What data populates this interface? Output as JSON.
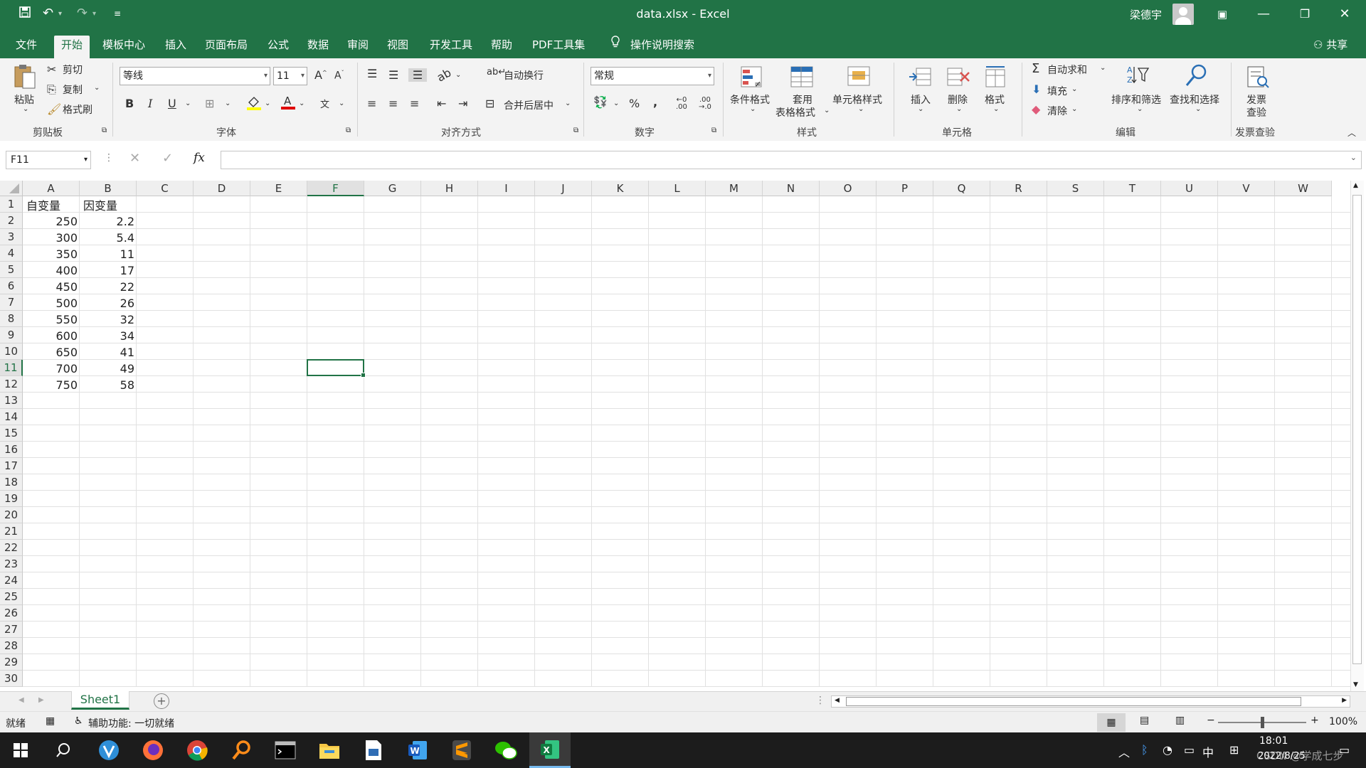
{
  "window": {
    "title": "data.xlsx  -  Excel",
    "user": "梁德宇"
  },
  "menu_tabs": [
    "文件",
    "开始",
    "模板中心",
    "插入",
    "页面布局",
    "公式",
    "数据",
    "审阅",
    "视图",
    "开发工具",
    "帮助",
    "PDF工具集"
  ],
  "active_tab": "开始",
  "tell_me": "操作说明搜索",
  "share": "共享",
  "ribbon": {
    "clipboard": {
      "label": "剪贴板",
      "paste": "粘贴",
      "cut": "剪切",
      "copy": "复制",
      "format_painter": "格式刷"
    },
    "font": {
      "label": "字体",
      "font_name": "等线",
      "font_size": "11",
      "bold": "B",
      "italic": "I",
      "underline": "U"
    },
    "alignment": {
      "label": "对齐方式",
      "wrap": "自动换行",
      "merge": "合并后居中"
    },
    "number": {
      "label": "数字",
      "format": "常规",
      "percent": "%",
      "comma": ","
    },
    "styles": {
      "label": "样式",
      "conditional": "条件格式",
      "table_format_1": "套用",
      "table_format_2": "表格格式",
      "cell_styles": "单元格样式"
    },
    "cells": {
      "label": "单元格",
      "insert": "插入",
      "delete": "删除",
      "format": "格式"
    },
    "editing": {
      "label": "编辑",
      "autosum": "自动求和",
      "fill": "填充",
      "clear": "清除",
      "sort": "排序和筛选",
      "find": "查找和选择"
    },
    "invoice": {
      "label": "发票查验",
      "btn_1": "发票",
      "btn_2": "查验"
    }
  },
  "formula_bar": {
    "name_box": "F11",
    "fx": "fx",
    "content": ""
  },
  "columns": [
    "A",
    "B",
    "C",
    "D",
    "E",
    "F",
    "G",
    "H",
    "I",
    "J",
    "K",
    "L",
    "M",
    "N",
    "O",
    "P",
    "Q",
    "R",
    "S",
    "T",
    "U",
    "V",
    "W"
  ],
  "selected_col": "F",
  "rows": [
    "1",
    "2",
    "3",
    "4",
    "5",
    "6",
    "7",
    "8",
    "9",
    "10",
    "11",
    "12",
    "13",
    "14",
    "15",
    "16",
    "17",
    "18",
    "19",
    "20",
    "21",
    "22",
    "23",
    "24",
    "25",
    "26",
    "27",
    "28",
    "29",
    "30"
  ],
  "selected_row": "11",
  "sheet_cells": {
    "A1": "自变量",
    "B1": "因变量",
    "A": [
      "250",
      "300",
      "350",
      "400",
      "450",
      "500",
      "550",
      "600",
      "650",
      "700",
      "750"
    ],
    "B": [
      "2.2",
      "5.4",
      "11",
      "17",
      "22",
      "26",
      "32",
      "34",
      "41",
      "49",
      "58"
    ]
  },
  "sheet_tab": "Sheet1",
  "status": {
    "ready": "就绪",
    "accessibility": "辅助功能: 一切就绪",
    "zoom": "100%"
  },
  "taskbar": {
    "time": "18:01",
    "date": "2022/8/25",
    "ime": "中",
    "watermark": "CSDN @学成七步"
  }
}
